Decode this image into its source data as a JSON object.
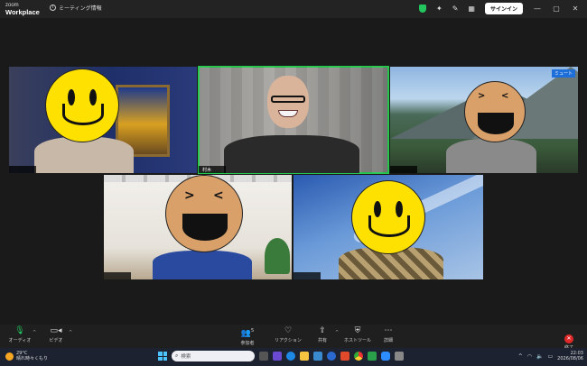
{
  "titlebar": {
    "logo_top": "zoom",
    "logo_bottom": "Workplace",
    "meeting_info_label": "ミーティング情報",
    "signin_label": "サインイン",
    "minimize": "—",
    "maximize": "▢",
    "close": "✕"
  },
  "tiles": [
    {
      "id": "p1",
      "name": ""
    },
    {
      "id": "p2",
      "name": "村木"
    },
    {
      "id": "p3",
      "name": "",
      "badge": "ミュート"
    },
    {
      "id": "p4",
      "name": ""
    },
    {
      "id": "p5",
      "name": ""
    }
  ],
  "toolbar": {
    "audio": "オーディオ",
    "video": "ビデオ",
    "participants": "参加者",
    "participants_count": "5",
    "reactions": "リアクション",
    "share": "共有",
    "host_tools": "ホストツール",
    "more": "詳細",
    "end": "終了"
  },
  "taskbar": {
    "temperature": "29°C",
    "weather": "晴れ時々くもり",
    "search_placeholder": "検索",
    "time": "22:03",
    "date": "2026/08/06"
  },
  "colors": {
    "active_speaker": "#27c84f",
    "end_red": "#e02828",
    "mute_blue": "#1e6fd9"
  }
}
